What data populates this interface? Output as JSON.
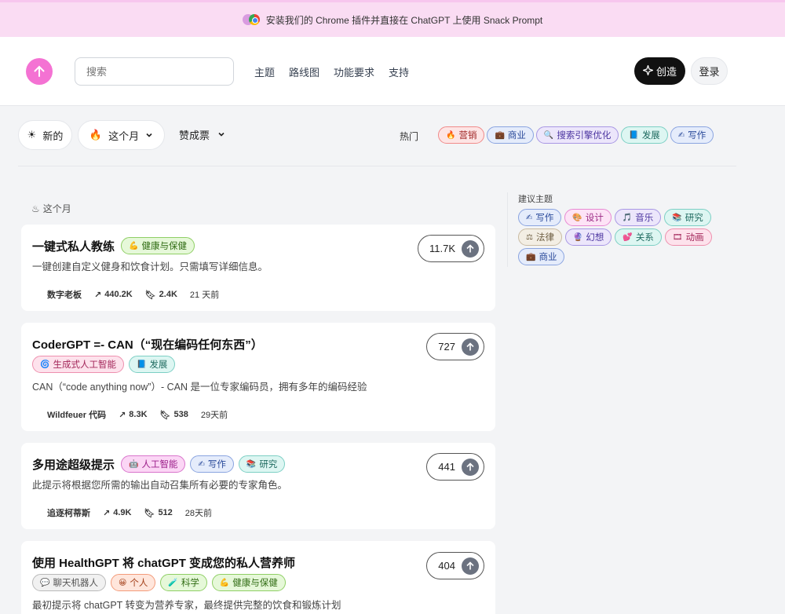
{
  "banner": {
    "text": "安装我们的 Chrome 插件并直接在 ChatGPT 上使用 Snack Prompt"
  },
  "header": {
    "search_placeholder": "搜索",
    "nav": [
      "主题",
      "路线图",
      "功能要求",
      "支持"
    ],
    "create_label": "创造",
    "login_label": "登录"
  },
  "filters": {
    "new_label": "新的",
    "month_label": "这个月",
    "votes_label": "赞成票",
    "hot_label": "热门",
    "hot_tags": [
      {
        "icon": "🔥",
        "label": "营销",
        "color": "red"
      },
      {
        "icon": "💼",
        "label": "商业",
        "color": "blue"
      },
      {
        "icon": "🔍",
        "label": "搜索引擎优化",
        "color": "purple"
      },
      {
        "icon": "📘",
        "label": "发展",
        "color": "teal"
      },
      {
        "icon": "✍",
        "label": "写作",
        "color": "blue"
      }
    ]
  },
  "section": {
    "label": "这个月"
  },
  "prompts": [
    {
      "title": "一键式私人教练",
      "inline_tags": [
        {
          "icon": "💪",
          "label": "健康与保健",
          "color": "green"
        }
      ],
      "tags": [],
      "description": "一键创建自定义健身和饮食计划。只需填写详细信息。",
      "author": "数字老板",
      "views": "440.2K",
      "saves": "2.4K",
      "time": "21 天前",
      "votes": "11.7K"
    },
    {
      "title": "CoderGPT =- CAN（“现在编码任何东西”）",
      "inline_tags": [],
      "tags": [
        {
          "icon": "🌀",
          "label": "生成式人工智能",
          "color": "rose"
        },
        {
          "icon": "📘",
          "label": "发展",
          "color": "teal"
        }
      ],
      "description": "CAN（“code anything now”）- CAN 是一位专家编码员，拥有多年的编码经验",
      "author": "Wildfeuer 代码",
      "views": "8.3K",
      "saves": "538",
      "time": "29天前",
      "votes": "727"
    },
    {
      "title": "多用途超级提示",
      "inline_tags": [
        {
          "icon": "🤖",
          "label": "人工智能",
          "color": "magenta"
        },
        {
          "icon": "✍",
          "label": "写作",
          "color": "blue"
        },
        {
          "icon": "📚",
          "label": "研究",
          "color": "teal"
        }
      ],
      "tags": [],
      "description": "此提示将根据您所需的输出自动召集所有必要的专家角色。",
      "author": "追逐柯蒂斯",
      "views": "4.9K",
      "saves": "512",
      "time": "28天前",
      "votes": "441"
    },
    {
      "title": "使用 HealthGPT 将 chatGPT 变成您的私人营养师",
      "inline_tags": [],
      "tags": [
        {
          "icon": "💬",
          "label": "聊天机器人",
          "color": "gray"
        },
        {
          "icon": "😀",
          "label": "个人",
          "color": "orange"
        },
        {
          "icon": "🧪",
          "label": "科学",
          "color": "green"
        },
        {
          "icon": "💪",
          "label": "健康与保健",
          "color": "green"
        }
      ],
      "description": "最初提示将 chatGPT 转变为营养专家，最终提供完整的饮食和锻炼计划",
      "author": "",
      "views": "",
      "saves": "",
      "time": "",
      "votes": "404"
    }
  ],
  "suggested": {
    "title": "建议主题",
    "tags": [
      {
        "icon": "✍",
        "label": "写作",
        "color": "blue"
      },
      {
        "icon": "🎨",
        "label": "设计",
        "color": "pink"
      },
      {
        "icon": "🎵",
        "label": "音乐",
        "color": "purple"
      },
      {
        "icon": "📚",
        "label": "研究",
        "color": "teal"
      },
      {
        "icon": "⚖",
        "label": "法律",
        "color": "beige"
      },
      {
        "icon": "🔮",
        "label": "幻想",
        "color": "purple"
      },
      {
        "icon": "💕",
        "label": "关系",
        "color": "teal"
      },
      {
        "icon": "🎞",
        "label": "动画",
        "color": "rose"
      },
      {
        "icon": "💼",
        "label": "商业",
        "color": "blue"
      }
    ]
  }
}
